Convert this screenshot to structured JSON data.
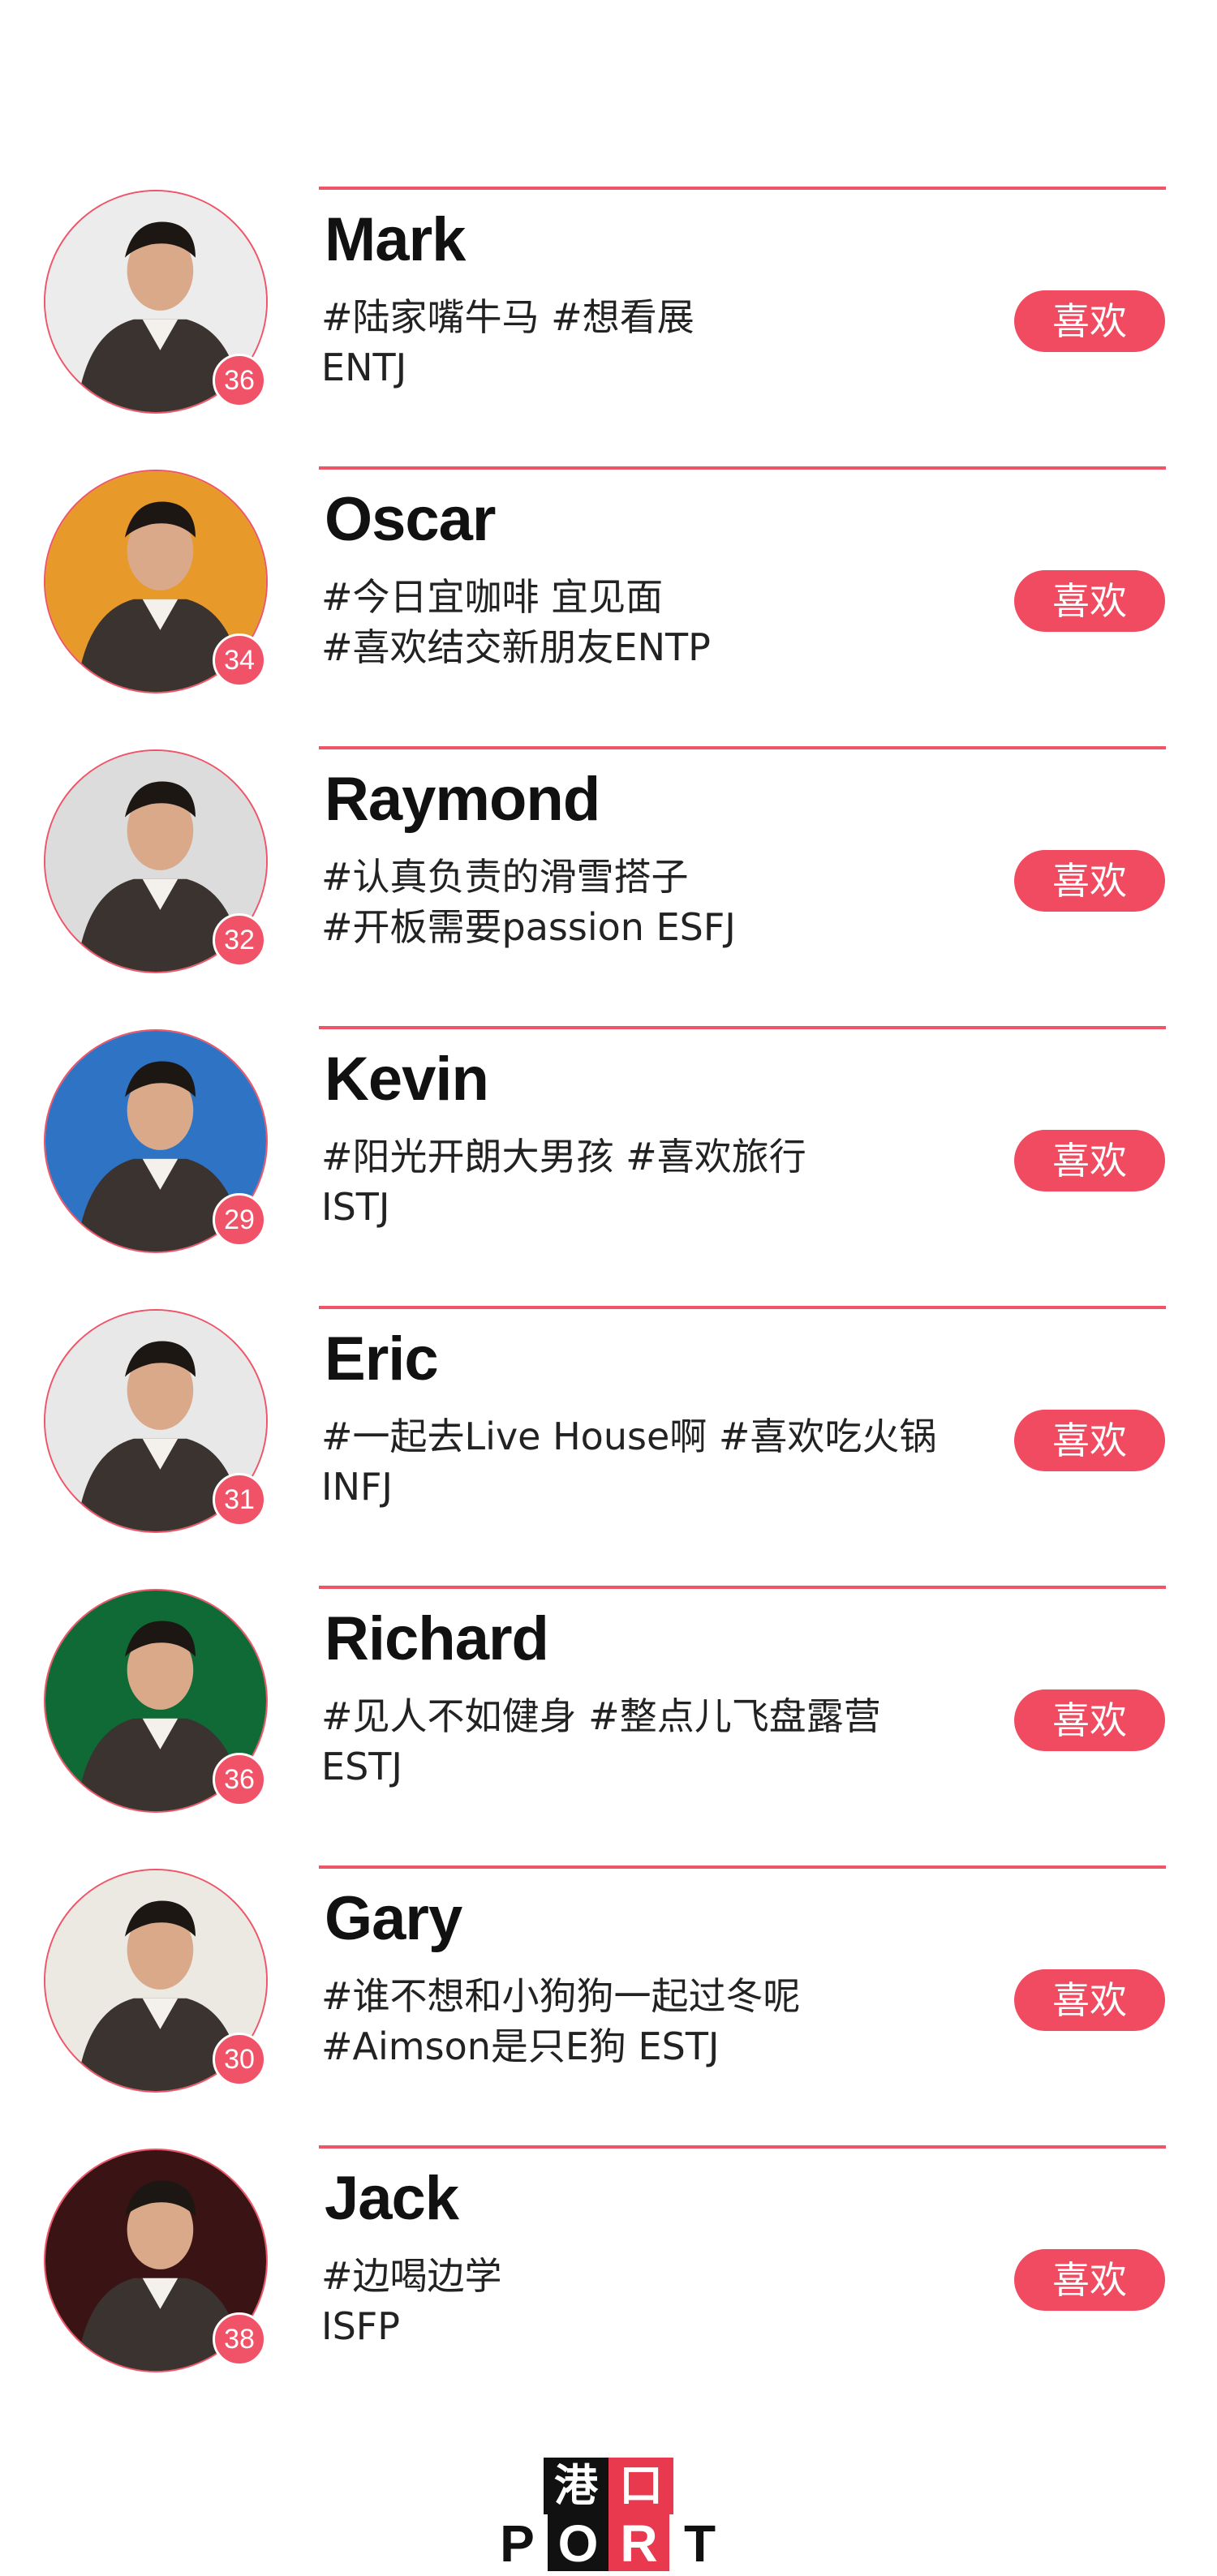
{
  "like_label": "喜欢",
  "accent_color": "#f04b60",
  "profiles": [
    {
      "name": "Mark",
      "age": "36",
      "line1": "#陆家嘴牛马 #想看展",
      "line2": "ENTJ",
      "avatar_bg": "#ececec"
    },
    {
      "name": "Oscar",
      "age": "34",
      "line1": "#今日宜咖啡 宜见面",
      "line2": "#喜欢结交新朋友ENTP",
      "avatar_bg": "#e79a2a"
    },
    {
      "name": "Raymond",
      "age": "32",
      "line1": "#认真负责的滑雪搭子",
      "line2": "#开板需要passion ESFJ",
      "avatar_bg": "#dcdcdc"
    },
    {
      "name": "Kevin",
      "age": "29",
      "line1": "#阳光开朗大男孩  #喜欢旅行",
      "line2": "ISTJ",
      "avatar_bg": "#2f74c4"
    },
    {
      "name": "Eric",
      "age": "31",
      "line1": "#一起去Live House啊 #喜欢吃火锅",
      "line2": "INFJ",
      "avatar_bg": "#e8e8e8"
    },
    {
      "name": "Richard",
      "age": "36",
      "line1": "#见人不如健身  #整点儿飞盘露营",
      "line2": "ESTJ",
      "avatar_bg": "#0f6a35"
    },
    {
      "name": "Gary",
      "age": "30",
      "line1": "#谁不想和小狗狗一起过冬呢",
      "line2": "#Aimson是只E狗  ESTJ",
      "avatar_bg": "#ece8e2"
    },
    {
      "name": "Jack",
      "age": "38",
      "line1": "#边喝边学",
      "line2": "ISFP",
      "avatar_bg": "#3a1414"
    }
  ],
  "logo": {
    "chars": [
      "港",
      "口"
    ],
    "letters": [
      "P",
      "O",
      "R",
      "T"
    ]
  }
}
